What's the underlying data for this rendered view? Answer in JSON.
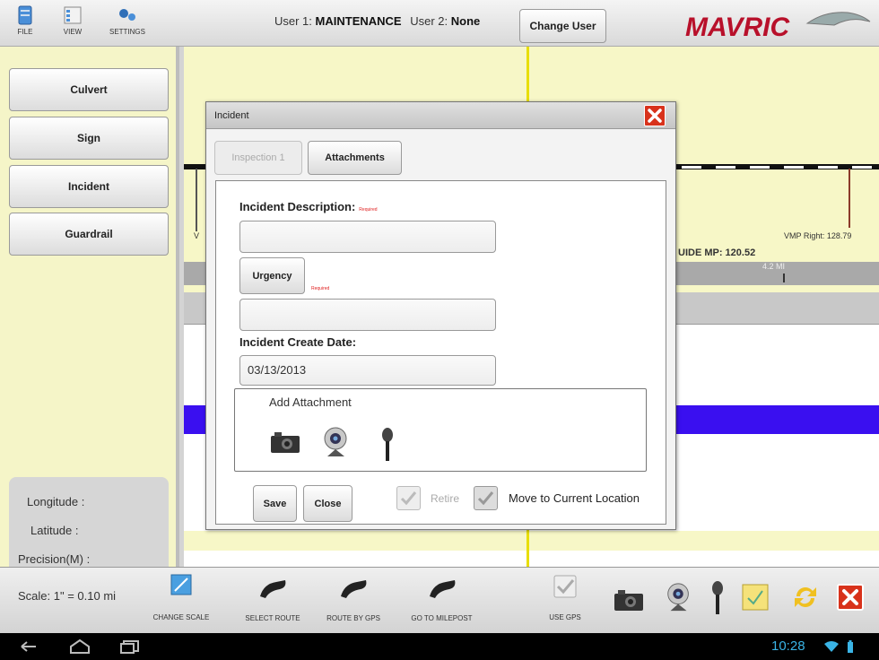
{
  "toolbar": {
    "file": "FILE",
    "view": "VIEW",
    "settings": "SETTINGS"
  },
  "users": {
    "user1_label": "User 1:",
    "user1_value": "MAINTENANCE",
    "user2_label": "User 2:",
    "user2_value": "None",
    "change_user": "Change User"
  },
  "logo_text": "MAVRIC",
  "left_buttons": [
    "Culvert",
    "Sign",
    "Incident",
    "Guardrail"
  ],
  "coords": {
    "longitude": "Longitude :",
    "latitude": "Latitude :",
    "precision": "Precision(M) :"
  },
  "map": {
    "vmp_left": "V",
    "vmp_right": "VMP Right: 128.79",
    "guide_mp": "UIDE MP: 120.52",
    "distance": "4.2 MI"
  },
  "dialog": {
    "title": "Incident",
    "tabs": [
      "Inspection 1",
      "Attachments"
    ],
    "incident_description_label": "Incident Description:",
    "required": "Required",
    "incident_description_value": "",
    "urgency_button": "Urgency",
    "urgency_value": "",
    "create_date_label": "Incident Create Date:",
    "create_date_value": "03/13/2013",
    "add_attachment": "Add Attachment",
    "save": "Save",
    "close": "Close",
    "retire": "Retire",
    "move_to_current": "Move to Current Location"
  },
  "bottom": {
    "scale": "Scale: 1\" = 0.10 mi",
    "change_scale": "CHANGE SCALE",
    "select_route": "SELECT ROUTE",
    "route_by_gps": "ROUTE BY GPS",
    "go_to_milepost": "GO TO MILEPOST",
    "use_gps": "USE GPS"
  },
  "status": {
    "time": "10:28"
  },
  "colors": {
    "map_background": "#f7f7c7",
    "route_blue": "#3a0ff0",
    "route_yellow": "#e8de00",
    "close_red": "#d8321b",
    "logo_red": "#b8102a"
  }
}
